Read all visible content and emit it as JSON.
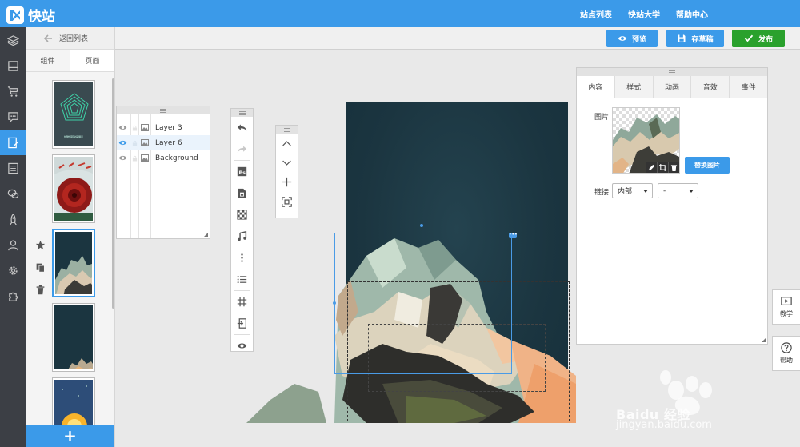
{
  "app": {
    "name": "快站"
  },
  "topnav": [
    "站点列表",
    "快站大学",
    "帮助中心"
  ],
  "pagepanel": {
    "back_label": "返回列表",
    "tabs": [
      "组件",
      "页面"
    ],
    "thumb_caption": "炫酷旋转动画展示"
  },
  "actions": {
    "preview": "预览",
    "save": "存草稿",
    "publish": "发布"
  },
  "colors": {
    "accent": "#3b9ae9",
    "publish": "#2aa12d",
    "dark_rail": "#3c3f45"
  },
  "layers": [
    "Layer 3",
    "Layer 6",
    "Background"
  ],
  "props": {
    "tabs": [
      "内容",
      "样式",
      "动画",
      "音效",
      "事件"
    ],
    "image_label": "图片",
    "replace_button": "替换图片",
    "link_label": "链接",
    "link_type": "内部",
    "link_target": "-"
  },
  "float_buttons": {
    "tutorial": "教学",
    "help": "帮助"
  },
  "watermark": {
    "brand": "Baidu 经验",
    "url": "jingyan.baidu.com"
  }
}
